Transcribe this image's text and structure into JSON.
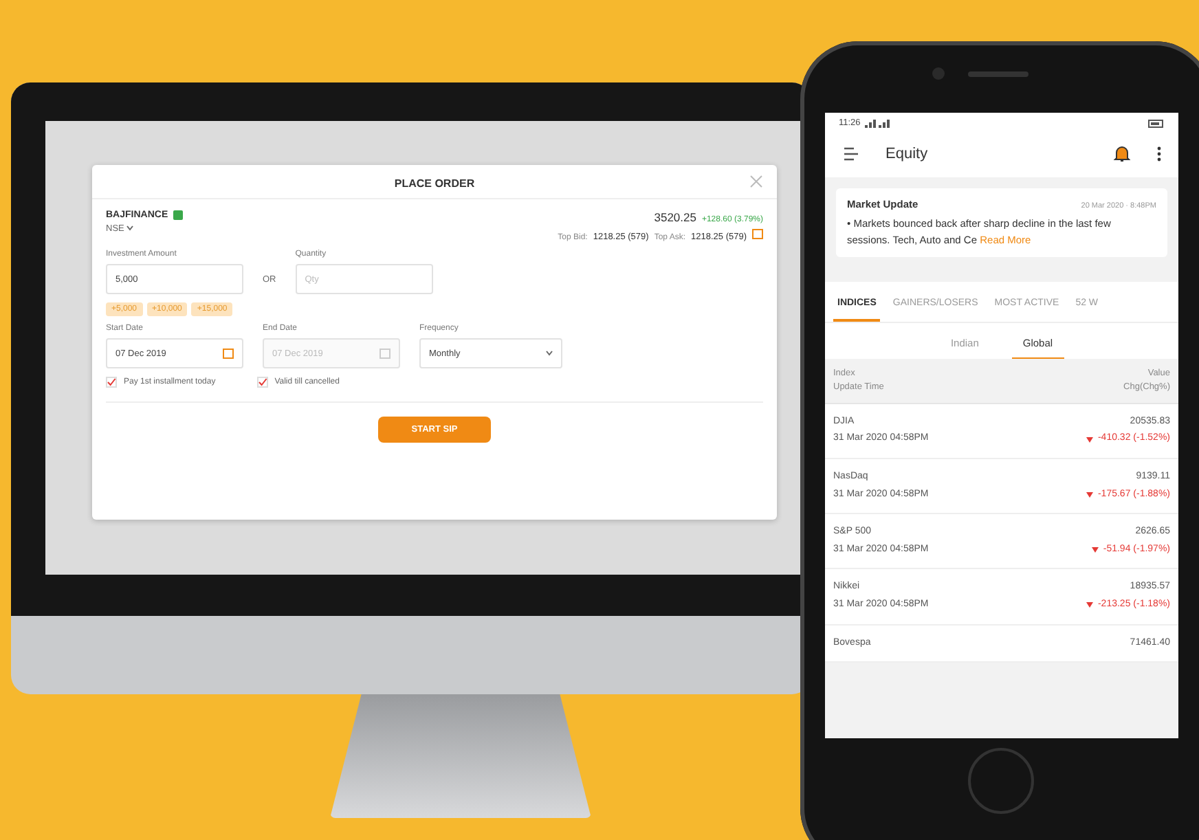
{
  "order_dialog": {
    "title": "PLACE ORDER",
    "symbol": "BAJFINANCE",
    "exchange": "NSE",
    "price": "3520.25",
    "change": "+128.60 (3.79%)",
    "top_bid_label": "Top Bid:",
    "top_bid": "1218.25 (579)",
    "top_ask_label": "Top Ask:",
    "top_ask": "1218.25 (579)",
    "amount_label": "Investment Amount",
    "amount_value": "5,000",
    "or_label": "OR",
    "quantity_label": "Quantity",
    "quantity_placeholder": "Qty",
    "chips": [
      "+5,000",
      "+10,000",
      "+15,000"
    ],
    "start_date_label": "Start Date",
    "start_date": "07 Dec 2019",
    "end_date_label": "End Date",
    "end_date": "07 Dec 2019",
    "end_date_disabled": true,
    "frequency_label": "Frequency",
    "frequency": "Monthly",
    "options": [
      {
        "label": "Pay 1st installment today",
        "checked": true
      },
      {
        "label": "Valid till cancelled",
        "checked": true
      }
    ],
    "submit": "START SIP"
  },
  "phone": {
    "status_time": "11:26",
    "title": "Equity",
    "update": {
      "title": "Market Update",
      "time": "20 Mar 2020 · 8:48PM",
      "text": "• Markets bounced back after sharp decline in the last few sessions. Tech, Auto and Ce",
      "link": "Read More"
    },
    "tabs": [
      {
        "label": "INDICES",
        "selected": true
      },
      {
        "label": "GAINERS/LOSERS",
        "selected": false
      },
      {
        "label": "MOST ACTIVE",
        "selected": false
      },
      {
        "label": "52 W",
        "selected": false
      }
    ],
    "subtabs": [
      {
        "label": "Indian",
        "selected": false
      },
      {
        "label": "Global",
        "selected": true
      }
    ],
    "header": {
      "col1": "Index",
      "col1_sub": "Update Time",
      "col2": "Value",
      "col2_sub": "Chg(Chg%)"
    },
    "rows": [
      {
        "name": "DJIA",
        "time": "31 Mar 2020 04:58PM",
        "value": "20535.83",
        "change": "-410.32 (-1.52%)"
      },
      {
        "name": "NasDaq",
        "time": "31 Mar 2020 04:58PM",
        "value": "9139.11",
        "change": "-175.67 (-1.88%)"
      },
      {
        "name": "S&P 500",
        "time": "31 Mar 2020 04:58PM",
        "value": "2626.65",
        "change": "-51.94 (-1.97%)"
      },
      {
        "name": "Nikkei",
        "time": "31 Mar 2020 04:58PM",
        "value": "18935.57",
        "change": "-213.25 (-1.18%)"
      },
      {
        "name": "Bovespa",
        "time": "",
        "value": "71461.40",
        "change": ""
      }
    ]
  }
}
